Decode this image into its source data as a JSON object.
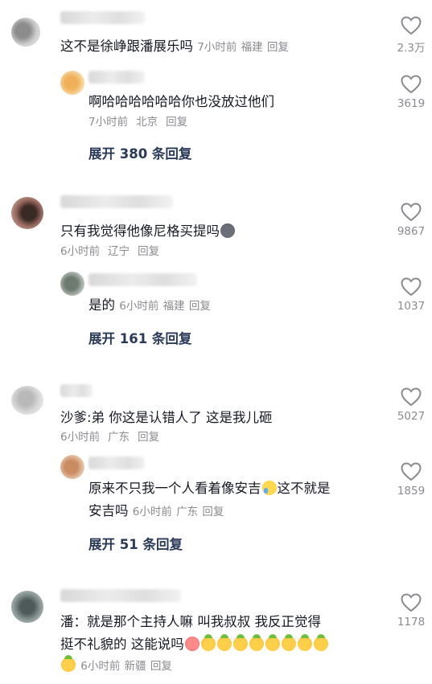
{
  "comments": [
    {
      "text": "这不是徐峥跟潘展乐吗",
      "time": "7小时前",
      "location": "福建",
      "reply": "回复",
      "likes": "2.3万",
      "icon": "heart-icon",
      "sub": {
        "text": "啊哈哈哈哈哈哈你也没放过他们",
        "time": "7小时前",
        "location": "北京",
        "reply": "回复",
        "likes": "3619"
      },
      "expand": "展开 380 条回复"
    },
    {
      "text": "只有我觉得他像尼格买提吗",
      "time": "6小时前",
      "location": "辽宁",
      "reply": "回复",
      "likes": "9867",
      "emoji": "dog-emoji",
      "sub": {
        "text": "是的",
        "time": "6小时前",
        "location": "福建",
        "reply": "回复",
        "likes": "1037"
      },
      "expand": "展开 161 条回复"
    },
    {
      "text": "沙爹:弟 你这是认错人了 这是我儿砸",
      "time": "6小时前",
      "location": "广东",
      "reply": "回复",
      "likes": "5027",
      "sub": {
        "text_line1": "原来不只我一个人看着像安吉",
        "text_line1_end": "这不就是",
        "text_line2": "安吉吗",
        "time": "6小时前",
        "location": "广东",
        "reply": "回复",
        "likes": "1859",
        "emoji": "crying-face-emoji"
      },
      "expand": "展开 51 条回复"
    },
    {
      "text_line1": "潘：就是那个主持人嘛  叫我叔叔 我反正觉得",
      "text_line2": "挺不礼貌的 这能说吗",
      "time": "6小时前",
      "location": "新疆",
      "reply": "回复",
      "likes": "1178",
      "emojis": [
        "angry-emoji",
        "pineapple-face-emoji"
      ]
    }
  ],
  "colors": {
    "text": "#161823",
    "meta": "#8a8b91",
    "expand": "#2a3b5a"
  }
}
